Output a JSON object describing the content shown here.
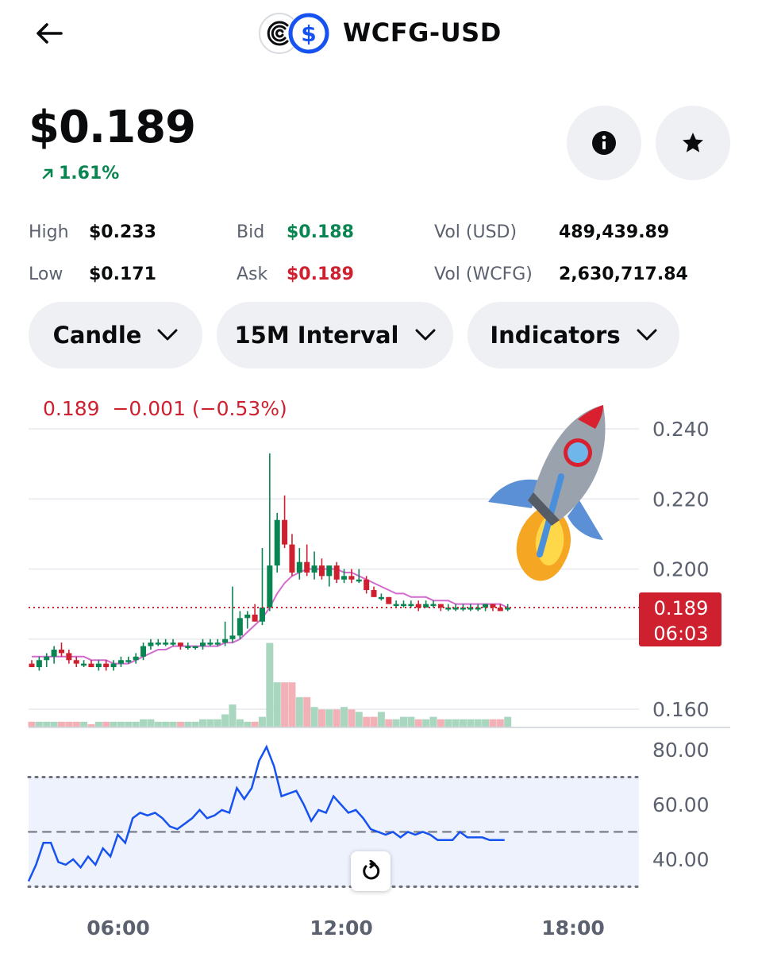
{
  "header": {
    "title": "WCFG-USD",
    "base_logo": "cfg-swirl-icon",
    "quote_logo": "usdc-dollar-icon"
  },
  "price": {
    "current": "$0.189",
    "change": "1.61%",
    "change_icon": "arrow-up-right-icon"
  },
  "stats": {
    "high_label": "High",
    "high": "$0.233",
    "low_label": "Low",
    "low": "$0.171",
    "bid_label": "Bid",
    "bid": "$0.188",
    "ask_label": "Ask",
    "ask": "$0.189",
    "vol_usd_label": "Vol (USD)",
    "vol_usd": "489,439.89",
    "vol_base_label": "Vol (WCFG)",
    "vol_base": "2,630,717.84"
  },
  "controls": {
    "chart_type": "Candle",
    "interval": "15M Interval",
    "indicators": "Indicators"
  },
  "chart": {
    "ohlc_label": "0.189  −0.001 (−0.53%)",
    "price_tag": "0.189",
    "countdown": "06:03",
    "colors": {
      "up": "#098551",
      "down": "#cf202f",
      "ma": "#d46ad0",
      "rsi": "#1652f0"
    }
  },
  "chart_data": [
    {
      "type": "candlestick",
      "x_ticks": [
        "06:00",
        "12:00",
        "18:00"
      ],
      "y_ticks": [
        "0.240",
        "0.220",
        "0.200",
        "0.160"
      ],
      "ylim": [
        0.16,
        0.24
      ],
      "candles": [
        [
          0.173,
          0.174,
          0.172,
          0.172
        ],
        [
          0.172,
          0.175,
          0.171,
          0.174
        ],
        [
          0.174,
          0.176,
          0.172,
          0.175
        ],
        [
          0.175,
          0.178,
          0.173,
          0.177
        ],
        [
          0.177,
          0.179,
          0.175,
          0.176
        ],
        [
          0.176,
          0.177,
          0.173,
          0.174
        ],
        [
          0.174,
          0.175,
          0.172,
          0.173
        ],
        [
          0.173,
          0.174,
          0.172,
          0.173
        ],
        [
          0.173,
          0.174,
          0.172,
          0.172
        ],
        [
          0.172,
          0.174,
          0.171,
          0.173
        ],
        [
          0.173,
          0.174,
          0.171,
          0.172
        ],
        [
          0.172,
          0.174,
          0.171,
          0.173
        ],
        [
          0.173,
          0.175,
          0.172,
          0.174
        ],
        [
          0.174,
          0.175,
          0.173,
          0.174
        ],
        [
          0.174,
          0.176,
          0.173,
          0.175
        ],
        [
          0.175,
          0.179,
          0.174,
          0.178
        ],
        [
          0.178,
          0.18,
          0.177,
          0.179
        ],
        [
          0.179,
          0.18,
          0.178,
          0.179
        ],
        [
          0.179,
          0.18,
          0.178,
          0.179
        ],
        [
          0.179,
          0.18,
          0.178,
          0.179
        ],
        [
          0.179,
          0.179,
          0.177,
          0.178
        ],
        [
          0.178,
          0.179,
          0.177,
          0.178
        ],
        [
          0.178,
          0.178,
          0.177,
          0.178
        ],
        [
          0.178,
          0.18,
          0.177,
          0.179
        ],
        [
          0.179,
          0.18,
          0.178,
          0.179
        ],
        [
          0.179,
          0.18,
          0.178,
          0.179
        ],
        [
          0.179,
          0.185,
          0.178,
          0.18
        ],
        [
          0.18,
          0.195,
          0.179,
          0.181
        ],
        [
          0.181,
          0.188,
          0.18,
          0.186
        ],
        [
          0.186,
          0.188,
          0.183,
          0.187
        ],
        [
          0.187,
          0.19,
          0.185,
          0.185
        ],
        [
          0.185,
          0.206,
          0.184,
          0.189
        ],
        [
          0.189,
          0.233,
          0.188,
          0.201
        ],
        [
          0.201,
          0.216,
          0.199,
          0.214
        ],
        [
          0.214,
          0.221,
          0.206,
          0.207
        ],
        [
          0.207,
          0.21,
          0.198,
          0.199
        ],
        [
          0.199,
          0.206,
          0.197,
          0.202
        ],
        [
          0.202,
          0.207,
          0.198,
          0.199
        ],
        [
          0.199,
          0.205,
          0.197,
          0.201
        ],
        [
          0.201,
          0.203,
          0.197,
          0.198
        ],
        [
          0.198,
          0.201,
          0.195,
          0.201
        ],
        [
          0.201,
          0.202,
          0.196,
          0.197
        ],
        [
          0.197,
          0.2,
          0.196,
          0.198
        ],
        [
          0.198,
          0.2,
          0.196,
          0.197
        ],
        [
          0.197,
          0.2,
          0.196,
          0.197
        ],
        [
          0.197,
          0.198,
          0.193,
          0.194
        ],
        [
          0.194,
          0.195,
          0.192,
          0.192
        ],
        [
          0.192,
          0.193,
          0.191,
          0.192
        ],
        [
          0.192,
          0.192,
          0.19,
          0.19
        ],
        [
          0.19,
          0.191,
          0.189,
          0.19
        ],
        [
          0.19,
          0.191,
          0.189,
          0.19
        ],
        [
          0.19,
          0.191,
          0.189,
          0.19
        ],
        [
          0.19,
          0.191,
          0.188,
          0.189
        ],
        [
          0.189,
          0.191,
          0.189,
          0.19
        ],
        [
          0.19,
          0.191,
          0.189,
          0.19
        ],
        [
          0.19,
          0.19,
          0.188,
          0.189
        ],
        [
          0.189,
          0.19,
          0.188,
          0.189
        ],
        [
          0.189,
          0.19,
          0.188,
          0.189
        ],
        [
          0.189,
          0.19,
          0.188,
          0.189
        ],
        [
          0.189,
          0.19,
          0.188,
          0.189
        ],
        [
          0.189,
          0.19,
          0.188,
          0.189
        ],
        [
          0.189,
          0.19,
          0.188,
          0.19
        ],
        [
          0.19,
          0.19,
          0.188,
          0.189
        ],
        [
          0.189,
          0.19,
          0.188,
          0.188
        ],
        [
          0.189,
          0.19,
          0.188,
          0.189
        ]
      ],
      "volume": [
        2,
        2,
        2,
        2,
        2,
        2,
        2,
        2,
        1,
        2,
        2,
        2,
        2,
        2,
        2,
        3,
        3,
        2,
        2,
        2,
        2,
        2,
        2,
        3,
        3,
        3,
        5,
        9,
        3,
        2,
        2,
        4,
        34,
        18,
        18,
        18,
        12,
        12,
        8,
        7,
        7,
        7,
        8,
        7,
        6,
        4,
        4,
        6,
        3,
        3,
        4,
        4,
        3,
        3,
        4,
        3,
        3,
        3,
        3,
        3,
        3,
        3,
        3,
        3,
        4
      ],
      "moving_average": [
        0.175,
        0.175,
        0.175,
        0.175,
        0.175,
        0.175,
        0.175,
        0.175,
        0.174,
        0.174,
        0.174,
        0.173,
        0.173,
        0.173,
        0.174,
        0.175,
        0.176,
        0.177,
        0.177,
        0.178,
        0.178,
        0.178,
        0.178,
        0.178,
        0.178,
        0.178,
        0.179,
        0.179,
        0.18,
        0.182,
        0.184,
        0.186,
        0.189,
        0.193,
        0.196,
        0.198,
        0.199,
        0.2,
        0.2,
        0.2,
        0.2,
        0.2,
        0.199,
        0.199,
        0.198,
        0.197,
        0.196,
        0.195,
        0.194,
        0.193,
        0.193,
        0.192,
        0.192,
        0.192,
        0.191,
        0.191,
        0.191,
        0.19,
        0.19,
        0.19,
        0.19,
        0.19,
        0.19,
        0.19,
        0.189
      ]
    },
    {
      "type": "line",
      "name": "RSI",
      "y_ticks": [
        "80.00",
        "60.00",
        "40.00"
      ],
      "ylim": [
        30,
        82
      ],
      "reference_lines": [
        70,
        50,
        30
      ],
      "values": [
        32,
        38,
        46,
        46,
        39,
        38,
        40,
        37,
        41,
        38,
        44,
        41,
        49,
        46,
        55,
        57,
        56,
        57,
        55,
        52,
        51,
        53,
        55,
        58,
        55,
        56,
        58,
        57,
        66,
        62,
        66,
        76,
        81,
        74,
        63,
        64,
        65,
        60,
        54,
        58,
        57,
        63,
        60,
        57,
        58,
        55,
        51,
        50,
        49,
        50,
        48,
        50,
        49,
        50,
        49,
        47,
        47,
        47,
        50,
        48,
        48,
        48,
        47,
        47,
        47
      ]
    }
  ]
}
